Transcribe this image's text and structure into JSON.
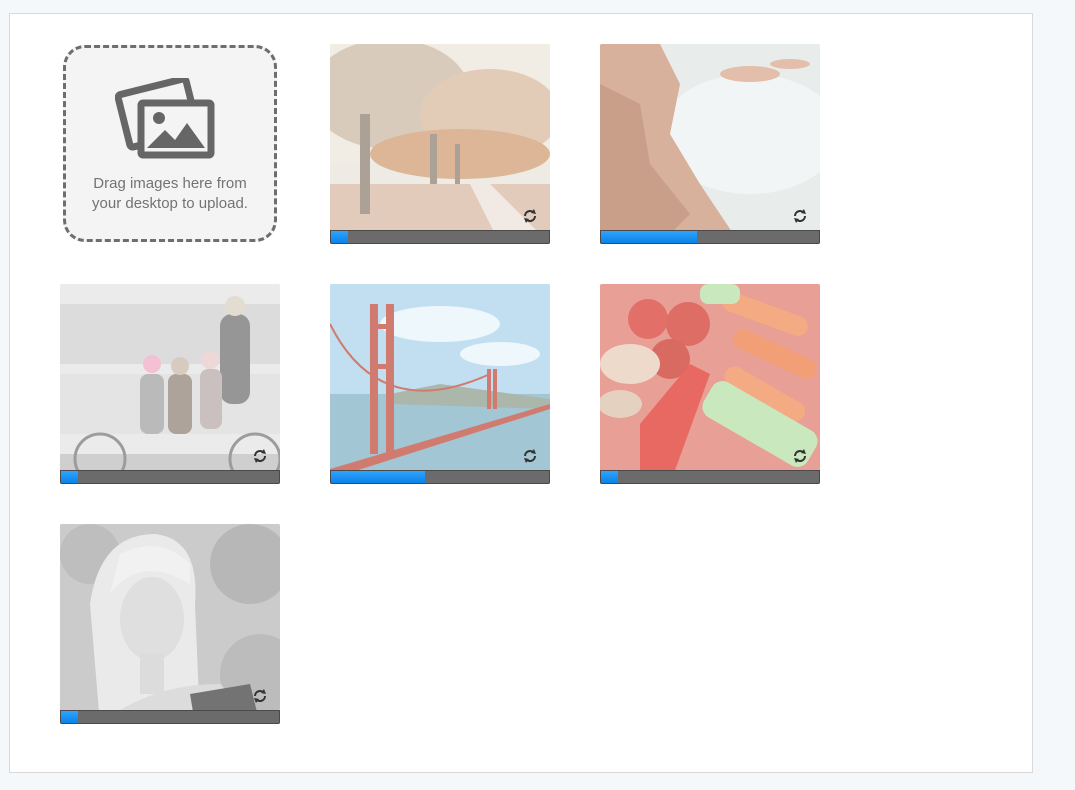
{
  "upload": {
    "dropzone": {
      "text_line1": "Drag images here from",
      "text_line2": "your desktop to upload."
    },
    "items": [
      {
        "subject": "autumn-tree-lined-path",
        "progress": 0.08
      },
      {
        "subject": "rocky-coast-misty-sea",
        "progress": 0.44
      },
      {
        "subject": "family-on-tandem-bicycle",
        "progress": 0.08
      },
      {
        "subject": "golden-gate-bridge",
        "progress": 0.43
      },
      {
        "subject": "tomatoes-carrots-peppers",
        "progress": 0.08
      },
      {
        "subject": "blonde-woman-portrait",
        "progress": 0.08
      }
    ],
    "retry_icon": "refresh-icon",
    "colors": {
      "accent": "#0a8ef0",
      "track": "#6b6b6b",
      "dashed_border": "#6e6e6e"
    }
  }
}
